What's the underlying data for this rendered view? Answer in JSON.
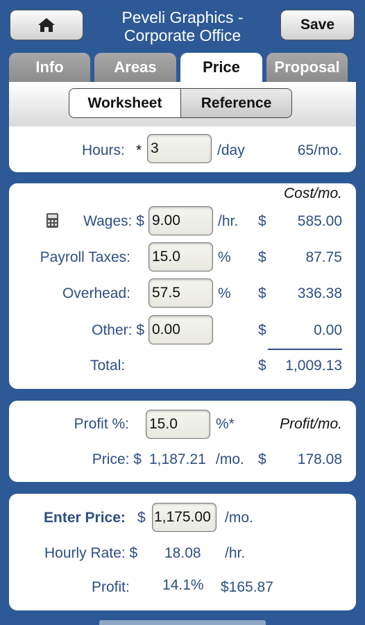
{
  "header": {
    "title_line1": "Peveli Graphics -",
    "title_line2": "Corporate Office",
    "home_icon": "home-icon",
    "save_label": "Save"
  },
  "tabs": [
    {
      "label": "Info",
      "active": false
    },
    {
      "label": "Areas",
      "active": false
    },
    {
      "label": "Price",
      "active": true
    },
    {
      "label": "Proposal",
      "active": false
    }
  ],
  "segments": {
    "left": "Worksheet",
    "right": "Reference",
    "selected": "Worksheet"
  },
  "hours": {
    "label": "Hours:",
    "required_mark": "*",
    "value": "3",
    "unit": "/day",
    "monthly": "65/mo."
  },
  "costs": {
    "header": "Cost/mo.",
    "calculator_icon": "calculator-icon",
    "wages": {
      "label": "Wages: $",
      "value": "9.00",
      "unit": "/hr.",
      "currency": "$",
      "amount": "585.00"
    },
    "payroll_taxes": {
      "label": "Payroll Taxes:",
      "value": "15.0",
      "unit": "%",
      "currency": "$",
      "amount": "87.75"
    },
    "overhead": {
      "label": "Overhead:",
      "value": "57.5",
      "unit": "%",
      "currency": "$",
      "amount": "336.38"
    },
    "other": {
      "label": "Other: $",
      "value": "0.00",
      "currency": "$",
      "amount": "0.00"
    },
    "total": {
      "label": "Total:",
      "currency": "$",
      "amount": "1,009.13"
    }
  },
  "profit": {
    "label": "Profit %:",
    "value": "15.0",
    "unit": "%*",
    "header": "Profit/mo.",
    "price_label": "Price: $",
    "price_value": "1,187.21",
    "price_unit": "/mo.",
    "currency": "$",
    "profit_amount": "178.08"
  },
  "enter_price": {
    "label": "Enter Price:",
    "currency": "$",
    "value": "1,175.00",
    "unit": "/mo.",
    "hourly_label": "Hourly Rate: $",
    "hourly_value": "18.08",
    "hourly_unit": "/hr.",
    "profit_label": "Profit:",
    "profit_percent": "14.1%",
    "profit_amount": "$165.87"
  },
  "colors": {
    "background": "#2d5996",
    "label_text": "#2e4f84",
    "panel": "#ffffff"
  }
}
